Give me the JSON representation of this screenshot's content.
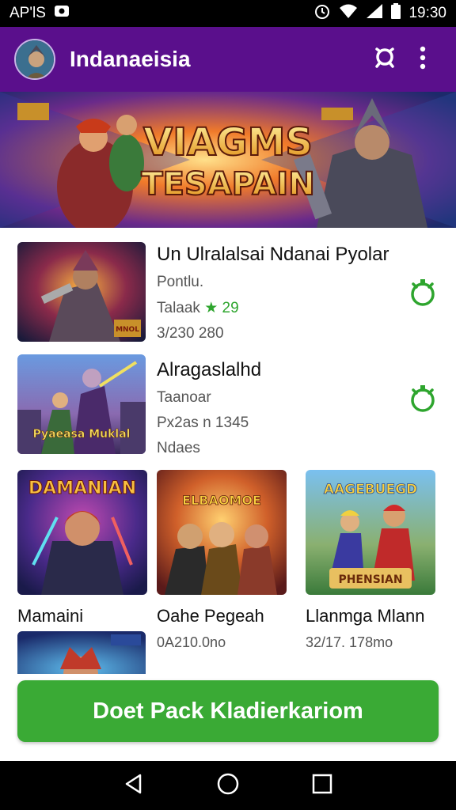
{
  "status_bar": {
    "left_text": "AP'lS",
    "time": "19:30",
    "icons": [
      "photo-icon",
      "alarm-icon",
      "wifi-icon",
      "signal-icon",
      "battery-icon"
    ]
  },
  "app_bar": {
    "title": "Indanaeisia",
    "icons": [
      "avatar",
      "search-icon",
      "more-vert-icon"
    ],
    "color": "#5a0f8c"
  },
  "banner": {
    "title_line1": "VIAGMS",
    "title_line2": "TESAPAIN"
  },
  "list": [
    {
      "title": "Un Ulralalsai Ndanai Pyolar",
      "line1": "Pontlu.",
      "rating_label": "Talaak",
      "rating_value": "29",
      "line3": "3/230 280",
      "badge": "MNOL",
      "icon": "download-icon"
    },
    {
      "title": "Alragaslalhd",
      "line1": "Taanoar",
      "line2": "Px2as n 1345",
      "line3": "Ndaes",
      "caption": "Pyaeasa Muklal",
      "icon": "download-icon"
    }
  ],
  "grid": [
    {
      "title": "Mamaini",
      "sub": "",
      "thumb_text": "DAMANIAN"
    },
    {
      "title": "Oahe Pegeah",
      "sub": "0A210.0no",
      "thumb_text": "ELBAOMOE"
    },
    {
      "title": "Llanmga Mlann",
      "sub": "32/17. 178mo",
      "thumb_text": "AAGEBUEGD",
      "thumb_text2": "PHENSIAN"
    }
  ],
  "cta": {
    "label": "Doet Pack Kladierkariom"
  },
  "colors": {
    "accent": "#3aaa35",
    "brand": "#5a0f8c",
    "rating": "#2ea52e"
  },
  "nav": {
    "icons": [
      "back-icon",
      "home-icon",
      "recents-icon"
    ]
  }
}
